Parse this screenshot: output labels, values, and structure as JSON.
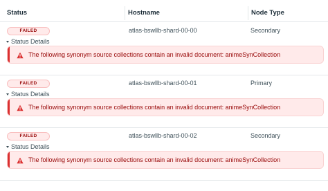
{
  "table": {
    "columns": {
      "status": "Status",
      "hostname": "Hostname",
      "node_type": "Node Type"
    },
    "rows": [
      {
        "status": "FAILED",
        "hostname": "atlas-bswllb-shard-00-00",
        "node_type": "Secondary",
        "details_label": "Status Details",
        "error": "The following synonym source collections contain an invalid document: animeSynCollection"
      },
      {
        "status": "FAILED",
        "hostname": "atlas-bswllb-shard-00-01",
        "node_type": "Primary",
        "details_label": "Status Details",
        "error": "The following synonym source collections contain an invalid document: animeSynCollection"
      },
      {
        "status": "FAILED",
        "hostname": "atlas-bswllb-shard-00-02",
        "node_type": "Secondary",
        "details_label": "Status Details",
        "error": "The following synonym source collections contain an invalid document: animeSynCollection"
      }
    ]
  },
  "colors": {
    "error_text": "#970606",
    "error_bg": "#ffeaea",
    "error_accent": "#db3030"
  },
  "icons": {
    "details_toggle": "caret-down-icon",
    "alert": "warning-triangle-icon"
  }
}
